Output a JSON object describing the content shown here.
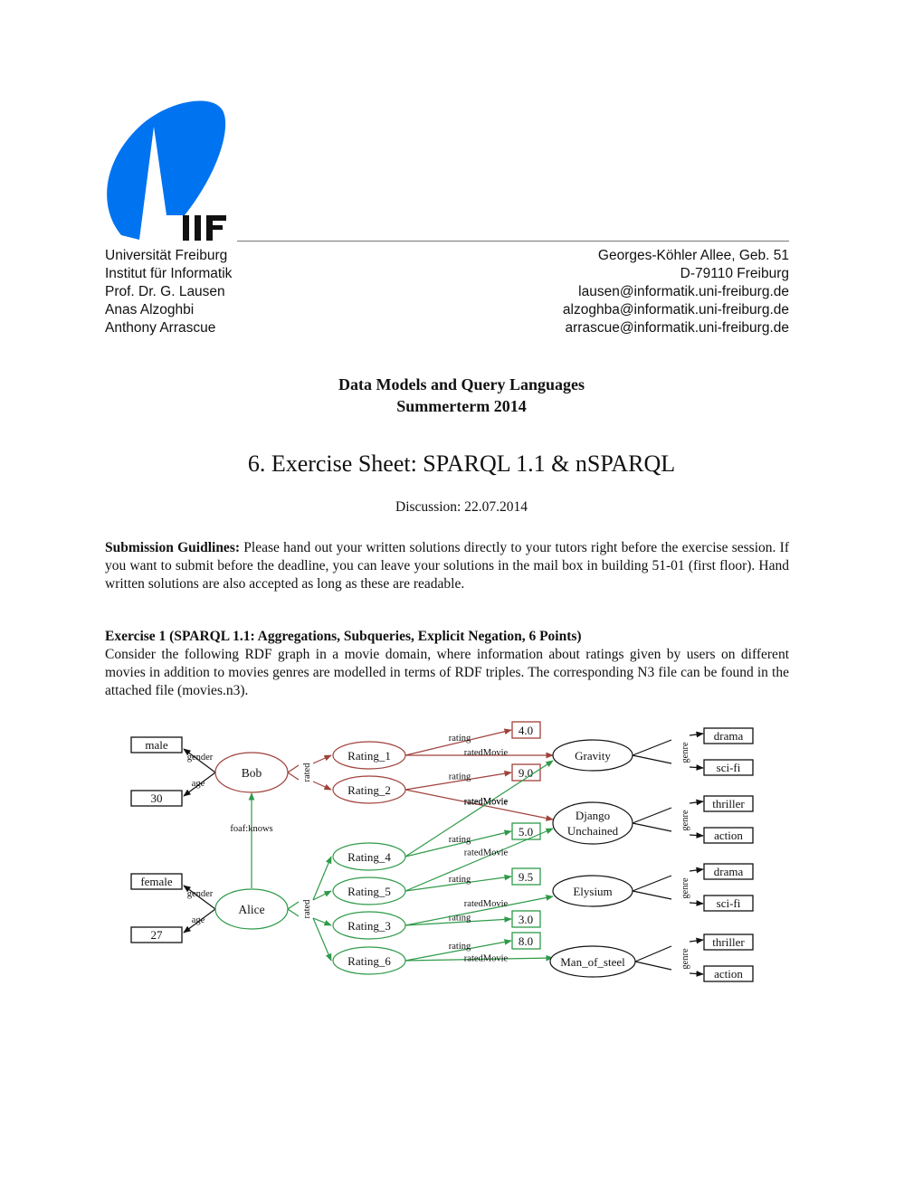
{
  "logo": {
    "text": "IIF",
    "brand_color": "#0073F0"
  },
  "header": {
    "left_lines": [
      "Universität Freiburg",
      "Institut für Informatik",
      "Prof. Dr. G. Lausen",
      "Anas Alzoghbi",
      "Anthony Arrascue"
    ],
    "right_lines": [
      "Georges-Köhler Allee, Geb. 51",
      "D-79110 Freiburg",
      "lausen@informatik.uni-freiburg.de",
      "alzoghba@informatik.uni-freiburg.de",
      "arrascue@informatik.uni-freiburg.de"
    ]
  },
  "course": {
    "title": "Data Models and Query Languages",
    "term": "Summerterm 2014"
  },
  "sheet": {
    "title": "6. Exercise Sheet: SPARQL 1.1 & nSPARQL",
    "discussion": "Discussion: 22.07.2014"
  },
  "submission": {
    "label": "Submission Guidlines:",
    "text": " Please hand out your written solutions directly to your tutors right before the exercise session. If you want to submit before the deadline, you can leave your solutions in the mail box in building 51-01 (first floor). Hand written solutions are also accepted as long as these are readable."
  },
  "exercise1": {
    "heading": "Exercise 1 (SPARQL 1.1: Aggregations, Subqueries, Explicit Negation, 6 Points)",
    "text": "Consider the following RDF graph in a movie domain, where information about ratings given by users on different movies in addition to movies genres are modelled in terms of RDF triples. The corresponding N3 file can be found in the attached file (movies.n3)."
  },
  "graph": {
    "colors": {
      "bob": "#A0413A",
      "alice": "#2E9A48",
      "neutral": "#111111"
    },
    "edge_labels": {
      "gender": "gender",
      "age": "age",
      "rated": "rated",
      "knows": "foaf:knows",
      "rating": "rating",
      "ratedMovie": "ratedMovie",
      "genre": "genre"
    },
    "users": [
      {
        "name": "Bob",
        "gender": "male",
        "age": "30",
        "color": "bob"
      },
      {
        "name": "Alice",
        "gender": "female",
        "age": "27",
        "color": "alice"
      }
    ],
    "ratings": [
      {
        "name": "Rating_1",
        "user": "Bob",
        "value": "4.0",
        "movie": "Gravity"
      },
      {
        "name": "Rating_2",
        "user": "Bob",
        "value": "9.0",
        "movie": "Django Unchained"
      },
      {
        "name": "Rating_4",
        "user": "Alice",
        "value": "5.0",
        "movie": "Gravity"
      },
      {
        "name": "Rating_5",
        "user": "Alice",
        "value": "9.5",
        "movie": "Django Unchained"
      },
      {
        "name": "Rating_3",
        "user": "Alice",
        "value": "3.0",
        "movie": "Elysium"
      },
      {
        "name": "Rating_6",
        "user": "Alice",
        "value": "8.0",
        "movie": "Man_of_steel"
      }
    ],
    "movies": [
      {
        "name": "Gravity",
        "lines": [
          "Gravity"
        ],
        "genres": [
          "drama",
          "sci-fi"
        ]
      },
      {
        "name": "Django Unchained",
        "lines": [
          "Django",
          "Unchained"
        ],
        "genres": [
          "thriller",
          "action"
        ]
      },
      {
        "name": "Elysium",
        "lines": [
          "Elysium"
        ],
        "genres": [
          "drama",
          "sci-fi"
        ]
      },
      {
        "name": "Man_of_steel",
        "lines": [
          "Man_of_steel"
        ],
        "genres": [
          "thriller",
          "action"
        ]
      }
    ]
  }
}
